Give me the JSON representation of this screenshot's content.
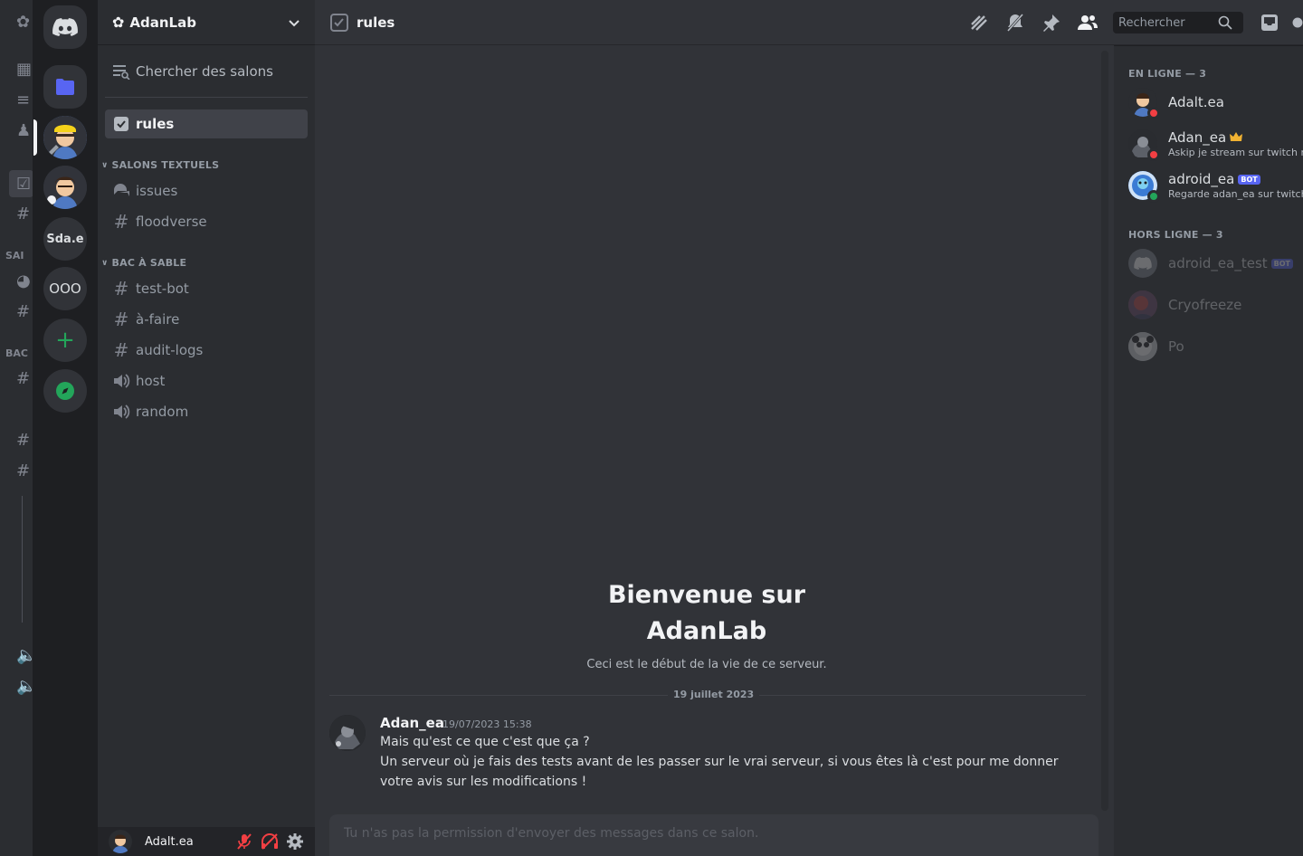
{
  "ghost": {
    "labels": [
      "SAI",
      "BAC"
    ]
  },
  "rail": {
    "servers": [
      {
        "text": "Sda.e"
      },
      {
        "text": "OOO"
      }
    ]
  },
  "guild": {
    "name": "AdanLab"
  },
  "sidebar": {
    "browse_label": "Chercher des salons",
    "active_channel": "rules",
    "categories": [
      {
        "label": "SALONS TEXTUELS",
        "channels": [
          {
            "name": "issues",
            "icon": "forum-icon"
          },
          {
            "name": "floodverse",
            "icon": "hash-icon"
          }
        ]
      },
      {
        "label": "BAC À SABLE",
        "channels": [
          {
            "name": "test-bot",
            "icon": "hash-icon"
          },
          {
            "name": "à-faire",
            "icon": "hash-icon"
          },
          {
            "name": "audit-logs",
            "icon": "hash-icon"
          },
          {
            "name": "host",
            "icon": "speaker-icon"
          },
          {
            "name": "random",
            "icon": "speaker-icon"
          }
        ]
      }
    ]
  },
  "user_panel": {
    "username": "Adalt.ea"
  },
  "topbar": {
    "channel": "rules",
    "search_placeholder": "Rechercher"
  },
  "welcome": {
    "title_line1": "Bienvenue sur",
    "title_line2": "AdanLab",
    "subtitle": "Ceci est le début de la vie de ce serveur."
  },
  "date_divider": "19 juillet 2023",
  "message": {
    "author": "Adan_ea",
    "timestamp": "19/07/2023 15:38",
    "lines": [
      "Mais qu'est ce que c'est que ça ?",
      "Un serveur où je fais des tests avant de les passer sur le vrai serveur, si vous êtes là c'est pour me donner",
      "votre avis sur les modifications !"
    ]
  },
  "composer_placeholder": "Tu n'as pas la permission d'envoyer des messages dans ce salon.",
  "members": {
    "online_header": "EN LIGNE — 3",
    "offline_header": "HORS LIGNE — 3",
    "online": [
      {
        "name": "Adalt.ea",
        "activity": "",
        "status": "dnd",
        "bot": false,
        "crown": false
      },
      {
        "name": "Adan_ea",
        "activity": "Askip je stream sur twitch ma",
        "status": "dnd",
        "bot": false,
        "crown": true
      },
      {
        "name": "adroid_ea",
        "activity": "Regarde adan_ea sur twitch",
        "status": "online",
        "bot": true,
        "crown": false
      }
    ],
    "offline": [
      {
        "name": "adroid_ea_test",
        "bot": true
      },
      {
        "name": "Cryofreeze",
        "bot": false
      },
      {
        "name": "Po",
        "bot": false
      }
    ],
    "bot_label": "BOT"
  },
  "colors": {
    "accent": "#5865f2",
    "dnd": "#f23f43",
    "online": "#23a55a",
    "crown": "#f0b232"
  }
}
